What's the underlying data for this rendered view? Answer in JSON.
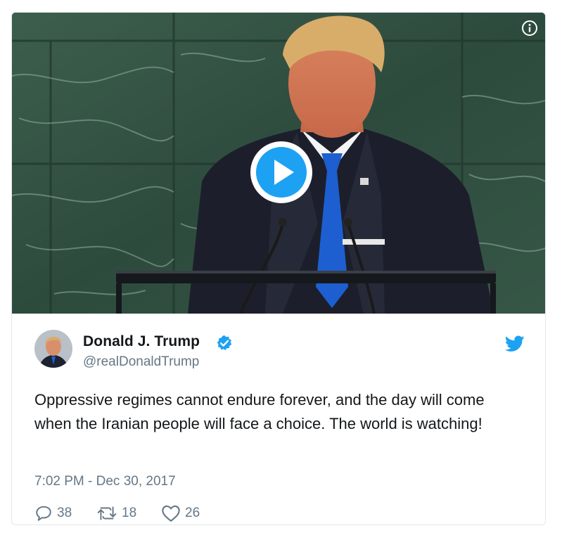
{
  "tweet": {
    "author_name": "Donald J. Trump",
    "author_handle": "@realDonaldTrump",
    "text": "Oppressive regimes cannot endure forever, and the day will come when the Iranian people will face a choice. The world is watching!",
    "timestamp": "7:02 PM - Dec 30, 2017",
    "verified": true
  },
  "actions": {
    "reply_count": "38",
    "retweet_count": "18",
    "like_count": "26"
  },
  "icons": {
    "info": "info-icon",
    "play": "play-icon",
    "verified": "verified-badge-icon",
    "twitter": "twitter-bird-icon",
    "reply": "reply-icon",
    "retweet": "retweet-icon",
    "like": "heart-icon"
  },
  "colors": {
    "brand_blue": "#1da1f2",
    "text_primary": "#14171a",
    "text_secondary": "#657786",
    "border": "#e1e8ed"
  }
}
